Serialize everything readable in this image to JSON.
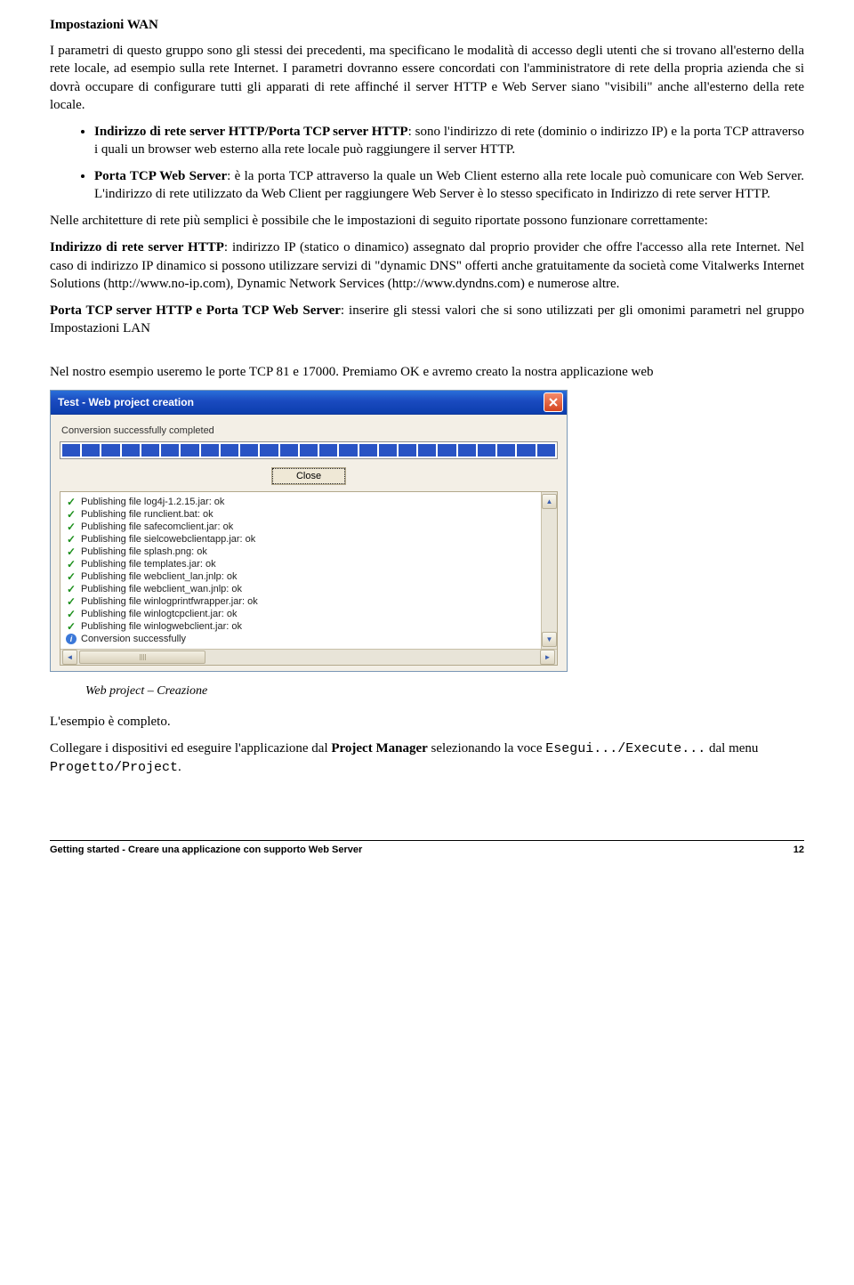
{
  "heading": "Impostazioni WAN",
  "para1": "I parametri di questo gruppo sono gli stessi dei precedenti, ma specificano le modalità di accesso degli utenti che si trovano all'esterno della rete locale, ad esempio sulla rete Internet. I parametri dovranno essere concordati con l'amministratore di rete della propria azienda che si dovrà occupare di configurare tutti gli apparati di rete affinché il server HTTP e Web Server siano \"visibili\" anche all'esterno della rete locale.",
  "bullet1": {
    "lead": "Indirizzo di rete server HTTP/Porta TCP server HTTP",
    "rest": ": sono l'indirizzo di rete (dominio o indirizzo IP) e la porta TCP attraverso i quali un browser web esterno alla rete locale può raggiungere il server HTTP."
  },
  "bullet2": {
    "lead": "Porta TCP Web Server",
    "rest": ": è la porta TCP attraverso la quale un Web Client esterno alla rete locale può comunicare con Web Server. L'indirizzo di rete utilizzato da Web Client per raggiungere Web Server è lo stesso specificato in Indirizzo di rete server HTTP."
  },
  "para2": "Nelle architetture di rete più semplici è possibile che le impostazioni di seguito riportate possono funzionare correttamente:",
  "para3": {
    "lead": "Indirizzo di rete server HTTP",
    "rest": ": indirizzo IP (statico o dinamico) assegnato dal proprio provider che offre l'accesso alla rete Internet. Nel caso di indirizzo IP dinamico si possono utilizzare servizi di \"dynamic DNS\" offerti anche gratuitamente da società come Vitalwerks Internet Solutions (http://www.no-ip.com), Dynamic Network Services (http://www.dyndns.com) e numerose altre."
  },
  "para4": {
    "lead": "Porta TCP server HTTP e Porta TCP Web Server",
    "rest": ": inserire gli stessi valori che si sono utilizzati per gli omonimi parametri nel gruppo Impostazioni LAN"
  },
  "para5": "Nel nostro esempio useremo le porte TCP 81 e 17000. Premiamo OK e avremo creato la nostra applicazione web",
  "window": {
    "title": "Test - Web project creation",
    "status": "Conversion successfully completed",
    "close_label": "Close",
    "log": [
      {
        "icon": "check",
        "text": "Publishing file log4j-1.2.15.jar: ok"
      },
      {
        "icon": "check",
        "text": "Publishing file runclient.bat: ok"
      },
      {
        "icon": "check",
        "text": "Publishing file safecomclient.jar: ok"
      },
      {
        "icon": "check",
        "text": "Publishing file sielcowebclientapp.jar: ok"
      },
      {
        "icon": "check",
        "text": "Publishing file splash.png: ok"
      },
      {
        "icon": "check",
        "text": "Publishing file templates.jar: ok"
      },
      {
        "icon": "check",
        "text": "Publishing file webclient_lan.jnlp: ok"
      },
      {
        "icon": "check",
        "text": "Publishing file webclient_wan.jnlp: ok"
      },
      {
        "icon": "check",
        "text": "Publishing file winlogprintfwrapper.jar: ok"
      },
      {
        "icon": "check",
        "text": "Publishing file winlogtcpclient.jar: ok"
      },
      {
        "icon": "check",
        "text": "Publishing file winlogwebclient.jar: ok"
      },
      {
        "icon": "info",
        "text": "Conversion successfully"
      }
    ]
  },
  "caption": "Web project – Creazione",
  "para6": "L'esempio è completo.",
  "para7a": "Collegare i dispositivi ed eseguire l'applicazione dal ",
  "para7b": "Project Manager",
  "para7c": " selezionando la voce ",
  "mono1": "Esegui.../Execute...",
  "para7d": " dal menu ",
  "mono2": "Progetto/Project",
  "para7e": ".",
  "footer": {
    "left": "Getting started - Creare una applicazione con supporto Web Server",
    "right": "12"
  }
}
